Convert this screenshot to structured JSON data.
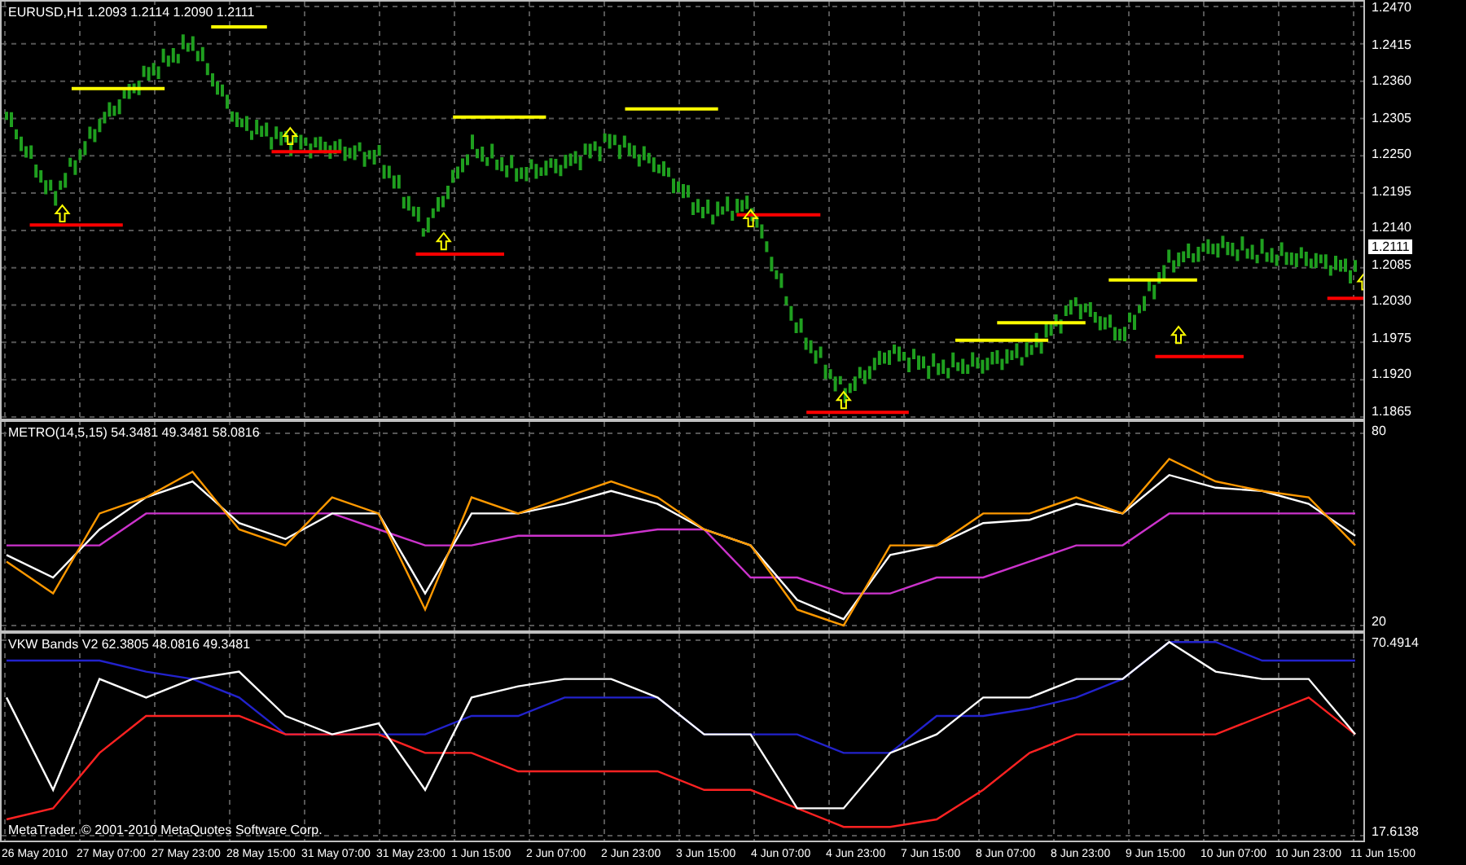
{
  "panes": [
    {
      "title": "EURUSD,H1  1.2093 1.2114 1.2090 1.2111",
      "axis": [
        "1.2470",
        "1.2415",
        "1.2360",
        "1.2305",
        "1.2250",
        "1.2195",
        "1.2140",
        "1.2085",
        "1.2030",
        "1.1975",
        "1.1920",
        "1.1865"
      ],
      "current_price": "1.2111"
    },
    {
      "title": "METRO(14,5,15) 54.3481 49.3481 58.0816",
      "chart_data": {
        "type": "line",
        "grid": true,
        "ylim": [
          20,
          80
        ],
        "yticks": [
          80,
          20
        ],
        "series": [
          {
            "color": "#cc33cc",
            "values": [
              45,
              45,
              45,
              55,
              55,
              55,
              55,
              55,
              50,
              45,
              45,
              48,
              48,
              48,
              50,
              50,
              35,
              35,
              30,
              30,
              35,
              35,
              40,
              45,
              45,
              55,
              55,
              55,
              55,
              55
            ]
          },
          {
            "color": "#ffffff",
            "values": [
              42,
              35,
              50,
              60,
              65,
              52,
              47,
              55,
              55,
              30,
              55,
              55,
              58,
              62,
              58,
              50,
              45,
              28,
              22,
              42,
              45,
              52,
              53,
              58,
              55,
              67,
              63,
              62,
              58,
              48
            ]
          },
          {
            "color": "#ff9900",
            "values": [
              40,
              30,
              55,
              60,
              68,
              50,
              45,
              60,
              55,
              25,
              60,
              55,
              60,
              65,
              60,
              50,
              45,
              25,
              20,
              45,
              45,
              55,
              55,
              60,
              55,
              72,
              65,
              62,
              60,
              45
            ]
          }
        ]
      }
    },
    {
      "title": "VKW Bands V2 62.3805 48.0816 49.3481",
      "footer": "MetaTrader. © 2001-2010 MetaQuotes Software Corp.",
      "chart_data": {
        "type": "line",
        "grid": true,
        "ylim": [
          17.6138,
          70.4914
        ],
        "yticks": [
          70.4914,
          17.6138
        ],
        "series": [
          {
            "color": "#2222cc",
            "values": [
              65,
              65,
              65,
              62,
              60,
              55,
              45,
              45,
              45,
              45,
              50,
              50,
              55,
              55,
              55,
              45,
              45,
              45,
              40,
              40,
              50,
              50,
              52,
              55,
              60,
              70,
              70,
              65,
              65,
              65
            ]
          },
          {
            "color": "#ff2222",
            "values": [
              22,
              25,
              40,
              50,
              50,
              50,
              45,
              45,
              45,
              40,
              40,
              35,
              35,
              35,
              35,
              30,
              30,
              25,
              20,
              20,
              22,
              30,
              40,
              45,
              45,
              45,
              45,
              50,
              55,
              45
            ]
          },
          {
            "color": "#ffffff",
            "values": [
              55,
              30,
              60,
              55,
              60,
              62,
              50,
              45,
              48,
              30,
              55,
              58,
              60,
              60,
              55,
              45,
              45,
              25,
              25,
              40,
              45,
              55,
              55,
              60,
              60,
              70,
              62,
              60,
              60,
              45
            ]
          }
        ]
      }
    }
  ],
  "time_axis": [
    "26 May 2010",
    "27 May 07:00",
    "27 May 23:00",
    "28 May 15:00",
    "31 May 07:00",
    "31 May 23:00",
    "1 Jun 15:00",
    "2 Jun 07:00",
    "2 Jun 23:00",
    "3 Jun 15:00",
    "4 Jun 07:00",
    "4 Jun 23:00",
    "7 Jun 15:00",
    "8 Jun 07:00",
    "8 Jun 23:00",
    "9 Jun 15:00",
    "10 Jun 07:00",
    "10 Jun 23:00",
    "11 Jun 15:00"
  ]
}
